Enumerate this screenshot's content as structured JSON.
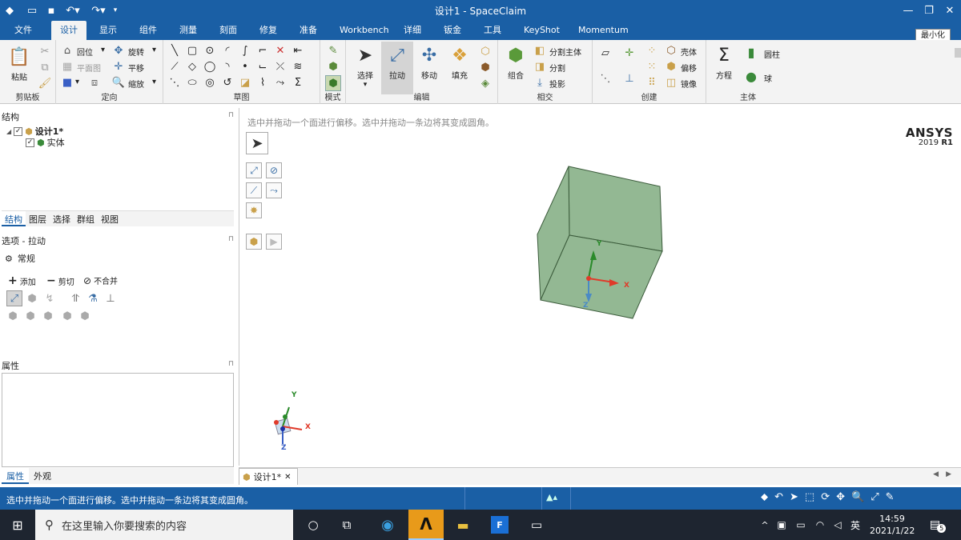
{
  "window": {
    "title": "设计1 - SpaceClaim",
    "minimize_tooltip": "最小化"
  },
  "tabs": [
    {
      "label": "文件"
    },
    {
      "label": "设计"
    },
    {
      "label": "显示"
    },
    {
      "label": "组件"
    },
    {
      "label": "测量"
    },
    {
      "label": "刻面"
    },
    {
      "label": "修复"
    },
    {
      "label": "准备"
    },
    {
      "label": "Workbench"
    },
    {
      "label": "详细"
    },
    {
      "label": "钣金"
    },
    {
      "label": "工具"
    },
    {
      "label": "KeyShot"
    },
    {
      "label": "Momentum"
    }
  ],
  "ribbon": {
    "clipboard": {
      "label": "剪贴板",
      "paste": "粘贴"
    },
    "orient": {
      "label": "定向",
      "home": "回位",
      "rotate": "旋转",
      "plane_view": "平面图",
      "pan": "平移",
      "zoom": "缩放"
    },
    "sketch": {
      "label": "草图"
    },
    "mode": {
      "label": "模式"
    },
    "edit": {
      "label": "编辑",
      "select": "选择",
      "pull": "拉动",
      "move": "移动",
      "fill": "填充"
    },
    "intersect": {
      "label": "相交",
      "combine": "组合",
      "split_body": "分割主体",
      "split": "分割",
      "project": "投影"
    },
    "create": {
      "label": "创建",
      "shell": "壳体",
      "offset": "偏移",
      "mirror": "镜像"
    },
    "body": {
      "label": "主体",
      "equation": "方程",
      "cylinder": "圆柱",
      "sphere": "球"
    }
  },
  "structure": {
    "header": "结构",
    "root": "设计1*",
    "child": "实体",
    "tabs": [
      "结构",
      "图层",
      "选择",
      "群组",
      "视图"
    ]
  },
  "options": {
    "header": "选项 - 拉动",
    "general": "常规",
    "add": "添加",
    "cut": "剪切",
    "no_merge": "不合并"
  },
  "properties": {
    "header": "属性",
    "tabs": [
      "属性",
      "外观"
    ]
  },
  "viewport": {
    "hint": "选中并拖动一个面进行偏移。选中并拖动一条边将其变成圆角。",
    "brand": "ANSYS",
    "version_year": "2019",
    "version_release": "R1",
    "axis_x": "X",
    "axis_y": "Y",
    "axis_z": "Z",
    "cube_color": "#93b893"
  },
  "doc_tab": {
    "label": "设计1*"
  },
  "status": {
    "text": "选中并拖动一个面进行偏移。选中并拖动一条边将其变成圆角。"
  },
  "taskbar": {
    "search_placeholder": "在这里输入你要搜索的内容",
    "time": "14:59",
    "date": "2021/1/22",
    "lang": "英",
    "notifications": "5"
  },
  "colors": {
    "accent": "#1a5fa5",
    "ribbon_bg": "#f3f3f3",
    "taskbar_bg": "#1e2530"
  }
}
